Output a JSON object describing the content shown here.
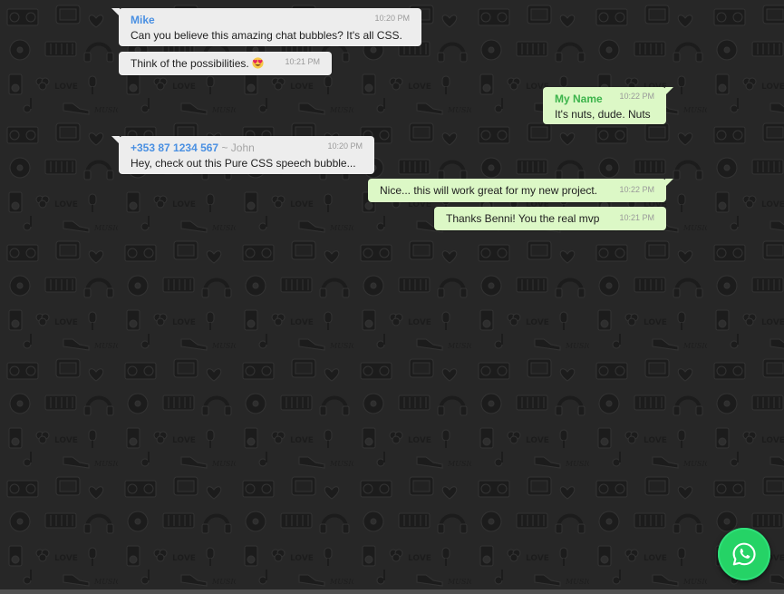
{
  "messages": [
    {
      "direction": "in",
      "sender": "Mike",
      "text": "Can you believe this amazing chat bubbles? It's all CSS.",
      "time": "10:20 PM"
    },
    {
      "direction": "in",
      "text": "Think of the possibilities.",
      "emoji": "smiling-face-with-heart-eyes-icon",
      "time": "10:21 PM"
    },
    {
      "direction": "out",
      "sender": "My Name",
      "text": "It's nuts, dude. Nuts",
      "time": "10:22 PM"
    },
    {
      "direction": "in",
      "sender_phone": "+353 87 1234 567",
      "sender_alias": " ~ John",
      "text": "Hey, check out this Pure CSS speech bubble...",
      "time": "10:20 PM"
    },
    {
      "direction": "out",
      "text": "Nice... this will work great for my new project.",
      "time": "10:22 PM"
    },
    {
      "direction": "out",
      "text": "Thanks Benni! You the real mvp",
      "time": "10:21 PM"
    }
  ],
  "fab": {
    "icon": "whatsapp-icon"
  },
  "colors": {
    "incoming_bubble": "#ededed",
    "outgoing_bubble": "#dcf8c6",
    "mike_name": "#4a90e2",
    "my_name": "#3cb44b",
    "fab_green": "#25d366",
    "wallpaper": "#272727"
  }
}
